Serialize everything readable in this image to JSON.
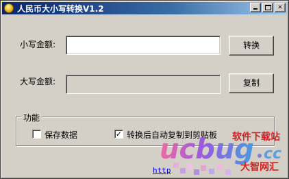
{
  "window": {
    "title": "人民币大小写转换V1.2"
  },
  "form": {
    "lower_label": "小写金额:",
    "lower_value": "",
    "convert_button": "转换",
    "upper_label": "大写金额:",
    "upper_value": "",
    "copy_button": "复制"
  },
  "features": {
    "group_title": "功能",
    "save_data": {
      "label": "保存数据",
      "checked": false
    },
    "auto_copy": {
      "label": "转换后自动复制到剪贴板",
      "checked": true
    }
  },
  "footer": {
    "link_text": "http"
  },
  "watermark": {
    "text_top": "软件下载站",
    "text_bottom": "大智网汇"
  },
  "colors": {
    "face": "#d4d0c8",
    "title_start": "#0a246a",
    "title_end": "#a6caf0"
  }
}
